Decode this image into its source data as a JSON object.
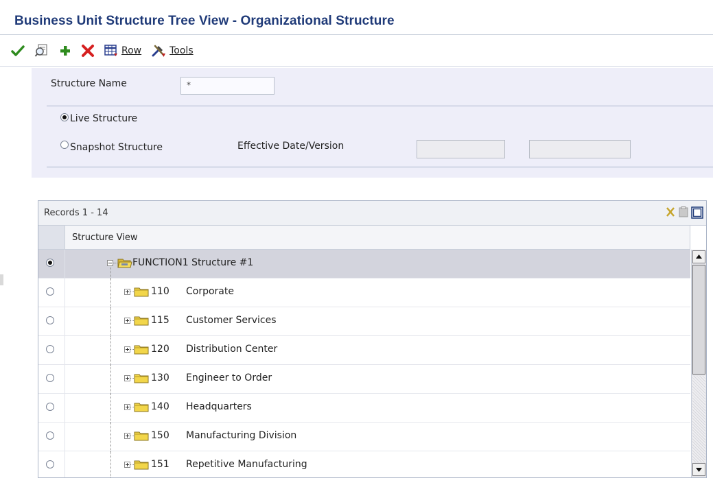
{
  "window": {
    "title": "Business Unit Structure Tree View - Organizational Structure"
  },
  "toolbar": {
    "select_icon": "checkmark-icon",
    "find_icon": "search-icon",
    "add_icon": "plus-icon",
    "delete_icon": "delete-x-icon",
    "row_label": "Row",
    "tools_label": "Tools"
  },
  "form": {
    "structure_name_label": "Structure Name",
    "structure_name_value": "*",
    "live_label": "Live Structure",
    "live_selected": true,
    "snapshot_label": "Snapshot Structure",
    "snapshot_selected": false,
    "effective_label": "Effective Date/Version",
    "effective_date_value": "",
    "version_value": ""
  },
  "grid": {
    "records_label": "Records 1 - 14",
    "column_header": "Structure View",
    "root": {
      "label": "FUNCTION1 Structure #1",
      "selected": true
    },
    "rows": [
      {
        "code": "110",
        "name": "Corporate"
      },
      {
        "code": "115",
        "name": "Customer Services"
      },
      {
        "code": "120",
        "name": "Distribution Center"
      },
      {
        "code": "130",
        "name": "Engineer to Order"
      },
      {
        "code": "140",
        "name": "Headquarters"
      },
      {
        "code": "150",
        "name": "Manufacturing Division"
      },
      {
        "code": "151",
        "name": "Repetitive Manufacturing"
      }
    ]
  },
  "colors": {
    "title": "#1f3a78",
    "panel_bg": "#eeeef9",
    "selected_row": "#d3d4dd",
    "check_green": "#2e8b1e",
    "delete_red": "#d62020",
    "folder_yellow": "#f2d64a"
  }
}
